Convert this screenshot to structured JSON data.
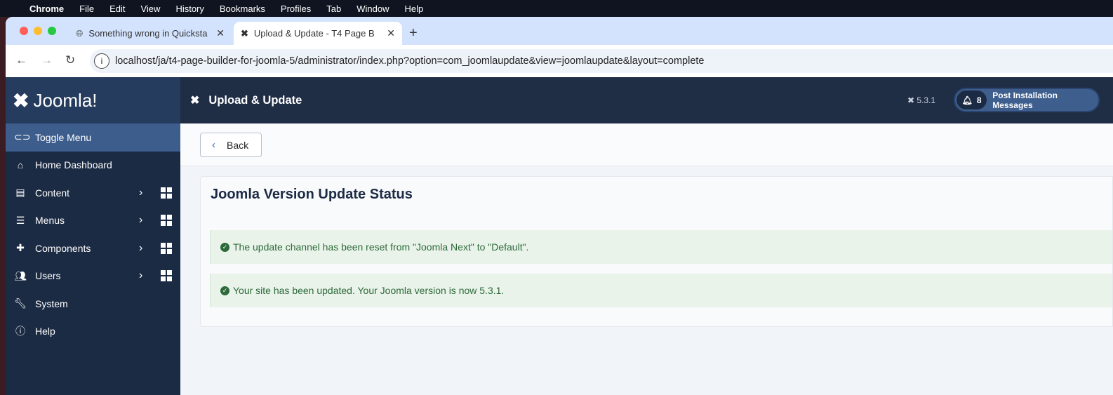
{
  "menubar": {
    "app": "Chrome",
    "items": [
      "File",
      "Edit",
      "View",
      "History",
      "Bookmarks",
      "Profiles",
      "Tab",
      "Window",
      "Help"
    ]
  },
  "browser": {
    "tabs": [
      {
        "title": "Something wrong in Quicksta",
        "icon": "globe-icon"
      },
      {
        "title": "Upload & Update - T4 Page B",
        "icon": "joomla-icon"
      }
    ],
    "url": "localhost/ja/t4-page-builder-for-joomla-5/administrator/index.php?option=com_joomlaupdate&view=joomlaupdate&layout=complete"
  },
  "sidebar": {
    "logo": "Joomla!",
    "toggle": "Toggle Menu",
    "items": [
      {
        "label": "Home Dashboard",
        "icon": "home-icon"
      },
      {
        "label": "Content",
        "icon": "file-icon"
      },
      {
        "label": "Menus",
        "icon": "list-icon"
      },
      {
        "label": "Components",
        "icon": "puzzle-icon"
      },
      {
        "label": "Users",
        "icon": "users-icon"
      },
      {
        "label": "System",
        "icon": "wrench-icon"
      },
      {
        "label": "Help",
        "icon": "info-icon"
      }
    ]
  },
  "header": {
    "title": "Upload & Update",
    "version": "5.3.1",
    "notifications_count": "8",
    "post_install_label": "Post Installation Messages"
  },
  "toolbar": {
    "back_label": "Back"
  },
  "card": {
    "title": "Joomla Version Update Status",
    "alerts": [
      "The update channel has been reset from \"Joomla Next\" to \"Default\".",
      "Your site has been updated. Your Joomla version is now 5.3.1."
    ]
  }
}
